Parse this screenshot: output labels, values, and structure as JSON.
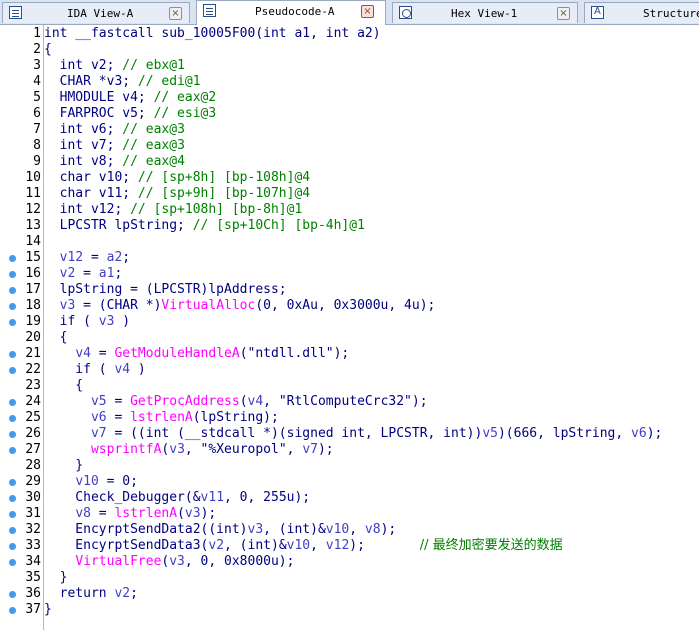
{
  "tabs": [
    {
      "label": "IDA View-A",
      "active": false,
      "icon": "ida-view-icon"
    },
    {
      "label": "Pseudocode-A",
      "active": true,
      "icon": "pseudocode-icon"
    },
    {
      "label": "Hex View-1",
      "active": false,
      "icon": "hex-view-icon"
    },
    {
      "label": "Structure",
      "active": false,
      "icon": "structure-icon"
    }
  ],
  "tab_close_label": "×",
  "colors": {
    "keyword": "#000080",
    "comment": "#008000",
    "import_call": "#ff00ff",
    "breakpoint": "#3d9be9"
  },
  "code_lines": [
    {
      "n": "1",
      "bp": false,
      "segs": [
        [
          "int __fastcall sub_10005F00(int a1, int a2)",
          "kw"
        ]
      ]
    },
    {
      "n": "2",
      "bp": false,
      "segs": [
        [
          "{",
          "kw"
        ]
      ]
    },
    {
      "n": "3",
      "bp": false,
      "segs": [
        [
          "  int v2; ",
          "kw"
        ],
        [
          "// ebx@1",
          "cm"
        ]
      ]
    },
    {
      "n": "4",
      "bp": false,
      "segs": [
        [
          "  CHAR *v3; ",
          "kw"
        ],
        [
          "// edi@1",
          "cm"
        ]
      ]
    },
    {
      "n": "5",
      "bp": false,
      "segs": [
        [
          "  HMODULE v4; ",
          "kw"
        ],
        [
          "// eax@2",
          "cm"
        ]
      ]
    },
    {
      "n": "6",
      "bp": false,
      "segs": [
        [
          "  FARPROC v5; ",
          "kw"
        ],
        [
          "// esi@3",
          "cm"
        ]
      ]
    },
    {
      "n": "7",
      "bp": false,
      "segs": [
        [
          "  int v6; ",
          "kw"
        ],
        [
          "// eax@3",
          "cm"
        ]
      ]
    },
    {
      "n": "8",
      "bp": false,
      "segs": [
        [
          "  int v7; ",
          "kw"
        ],
        [
          "// eax@3",
          "cm"
        ]
      ]
    },
    {
      "n": "9",
      "bp": false,
      "segs": [
        [
          "  int v8; ",
          "kw"
        ],
        [
          "// eax@4",
          "cm"
        ]
      ]
    },
    {
      "n": "10",
      "bp": false,
      "segs": [
        [
          "  char v10; ",
          "kw"
        ],
        [
          "// [sp+8h] [bp-108h]@4",
          "cm"
        ]
      ]
    },
    {
      "n": "11",
      "bp": false,
      "segs": [
        [
          "  char v11; ",
          "kw"
        ],
        [
          "// [sp+9h] [bp-107h]@4",
          "cm"
        ]
      ]
    },
    {
      "n": "12",
      "bp": false,
      "segs": [
        [
          "  int v12; ",
          "kw"
        ],
        [
          "// [sp+108h] [bp-8h]@1",
          "cm"
        ]
      ]
    },
    {
      "n": "13",
      "bp": false,
      "segs": [
        [
          "  LPCSTR lpString; ",
          "kw"
        ],
        [
          "// [sp+10Ch] [bp-4h]@1",
          "cm"
        ]
      ]
    },
    {
      "n": "14",
      "bp": false,
      "segs": [
        [
          "",
          "kw"
        ]
      ]
    },
    {
      "n": "15",
      "bp": true,
      "segs": [
        [
          "  ",
          "kw"
        ],
        [
          "v12",
          "lv"
        ],
        [
          " = ",
          "kw"
        ],
        [
          "a2",
          "lv"
        ],
        [
          ";",
          "kw"
        ]
      ]
    },
    {
      "n": "16",
      "bp": true,
      "segs": [
        [
          "  ",
          "kw"
        ],
        [
          "v2",
          "lv"
        ],
        [
          " = ",
          "kw"
        ],
        [
          "a1",
          "lv"
        ],
        [
          ";",
          "kw"
        ]
      ]
    },
    {
      "n": "17",
      "bp": true,
      "segs": [
        [
          "  lpString = (LPCSTR)lpAddress;",
          "kw"
        ]
      ]
    },
    {
      "n": "18",
      "bp": true,
      "segs": [
        [
          "  ",
          "kw"
        ],
        [
          "v3",
          "lv"
        ],
        [
          " = (CHAR *)",
          "kw"
        ],
        [
          "VirtualAlloc",
          "imp"
        ],
        [
          "(0, 0xAu, 0x3000u, 4u);",
          "kw"
        ]
      ]
    },
    {
      "n": "19",
      "bp": true,
      "segs": [
        [
          "  if ( ",
          "kw"
        ],
        [
          "v3",
          "lv"
        ],
        [
          " )",
          "kw"
        ]
      ]
    },
    {
      "n": "20",
      "bp": false,
      "segs": [
        [
          "  {",
          "kw"
        ]
      ]
    },
    {
      "n": "21",
      "bp": true,
      "segs": [
        [
          "    ",
          "kw"
        ],
        [
          "v4",
          "lv"
        ],
        [
          " = ",
          "kw"
        ],
        [
          "GetModuleHandleA",
          "imp"
        ],
        [
          "(\"ntdll.dll\");",
          "kw"
        ]
      ]
    },
    {
      "n": "22",
      "bp": true,
      "segs": [
        [
          "    if ( ",
          "kw"
        ],
        [
          "v4",
          "lv"
        ],
        [
          " )",
          "kw"
        ]
      ]
    },
    {
      "n": "23",
      "bp": false,
      "segs": [
        [
          "    {",
          "kw"
        ]
      ]
    },
    {
      "n": "24",
      "bp": true,
      "segs": [
        [
          "      ",
          "kw"
        ],
        [
          "v5",
          "lv"
        ],
        [
          " = ",
          "kw"
        ],
        [
          "GetProcAddress",
          "imp"
        ],
        [
          "(",
          "kw"
        ],
        [
          "v4",
          "lv"
        ],
        [
          ", \"RtlComputeCrc32\");",
          "kw"
        ]
      ]
    },
    {
      "n": "25",
      "bp": true,
      "segs": [
        [
          "      ",
          "kw"
        ],
        [
          "v6",
          "lv"
        ],
        [
          " = ",
          "kw"
        ],
        [
          "lstrlenA",
          "imp"
        ],
        [
          "(lpString);",
          "kw"
        ]
      ]
    },
    {
      "n": "26",
      "bp": true,
      "segs": [
        [
          "      ",
          "kw"
        ],
        [
          "v7",
          "lv"
        ],
        [
          " = ((int (__stdcall *)(signed int, LPCSTR, int))",
          "kw"
        ],
        [
          "v5",
          "lv"
        ],
        [
          ")(666, lpString, ",
          "kw"
        ],
        [
          "v6",
          "lv"
        ],
        [
          ");",
          "kw"
        ]
      ]
    },
    {
      "n": "27",
      "bp": true,
      "segs": [
        [
          "      ",
          "kw"
        ],
        [
          "wsprintfA",
          "imp"
        ],
        [
          "(",
          "kw"
        ],
        [
          "v3",
          "lv"
        ],
        [
          ", \"%Xeuropol\", ",
          "kw"
        ],
        [
          "v7",
          "lv"
        ],
        [
          ");",
          "kw"
        ]
      ]
    },
    {
      "n": "28",
      "bp": false,
      "segs": [
        [
          "    }",
          "kw"
        ]
      ]
    },
    {
      "n": "29",
      "bp": true,
      "segs": [
        [
          "    ",
          "kw"
        ],
        [
          "v10",
          "lv"
        ],
        [
          " = 0;",
          "kw"
        ]
      ]
    },
    {
      "n": "30",
      "bp": true,
      "segs": [
        [
          "    Check_Debugger(&",
          "kw"
        ],
        [
          "v11",
          "lv"
        ],
        [
          ", 0, 255u);",
          "kw"
        ]
      ]
    },
    {
      "n": "31",
      "bp": true,
      "segs": [
        [
          "    ",
          "kw"
        ],
        [
          "v8",
          "lv"
        ],
        [
          " = ",
          "kw"
        ],
        [
          "lstrlenA",
          "imp"
        ],
        [
          "(",
          "kw"
        ],
        [
          "v3",
          "lv"
        ],
        [
          ");",
          "kw"
        ]
      ]
    },
    {
      "n": "32",
      "bp": true,
      "segs": [
        [
          "    EncyrptSendData2((int)",
          "kw"
        ],
        [
          "v3",
          "lv"
        ],
        [
          ", (int)&",
          "kw"
        ],
        [
          "v10",
          "lv"
        ],
        [
          ", ",
          "kw"
        ],
        [
          "v8",
          "lv"
        ],
        [
          ");",
          "kw"
        ]
      ]
    },
    {
      "n": "33",
      "bp": true,
      "segs": [
        [
          "    EncyrptSendData3(",
          "kw"
        ],
        [
          "v2",
          "lv"
        ],
        [
          ", (int)&",
          "kw"
        ],
        [
          "v10",
          "lv"
        ],
        [
          ", ",
          "kw"
        ],
        [
          "v12",
          "lv"
        ],
        [
          ");       ",
          "kw"
        ],
        [
          "// 最终加密要发送的数据",
          "cn"
        ]
      ]
    },
    {
      "n": "34",
      "bp": true,
      "segs": [
        [
          "    ",
          "kw"
        ],
        [
          "VirtualFree",
          "imp"
        ],
        [
          "(",
          "kw"
        ],
        [
          "v3",
          "lv"
        ],
        [
          ", 0, 0x8000u);",
          "kw"
        ]
      ]
    },
    {
      "n": "35",
      "bp": false,
      "segs": [
        [
          "  }",
          "kw"
        ]
      ]
    },
    {
      "n": "36",
      "bp": true,
      "segs": [
        [
          "  return ",
          "kw"
        ],
        [
          "v2",
          "lv"
        ],
        [
          ";",
          "kw"
        ]
      ]
    },
    {
      "n": "37",
      "bp": true,
      "segs": [
        [
          "}",
          "kw"
        ]
      ]
    }
  ]
}
